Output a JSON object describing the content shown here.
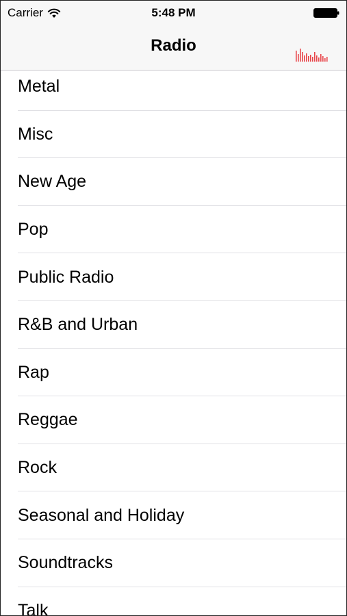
{
  "status_bar": {
    "carrier": "Carrier",
    "time": "5:48 PM",
    "wifi_icon": "wifi-icon",
    "battery_icon": "battery-icon"
  },
  "nav": {
    "title": "Radio",
    "right_icon": "now-playing-equalizer-icon",
    "accent_color": "#e8454a"
  },
  "genres": [
    "Metal",
    "Misc",
    "New Age",
    "Pop",
    "Public Radio",
    "R&B and Urban",
    "Rap",
    "Reggae",
    "Rock",
    "Seasonal and Holiday",
    "Soundtracks",
    "Talk"
  ]
}
